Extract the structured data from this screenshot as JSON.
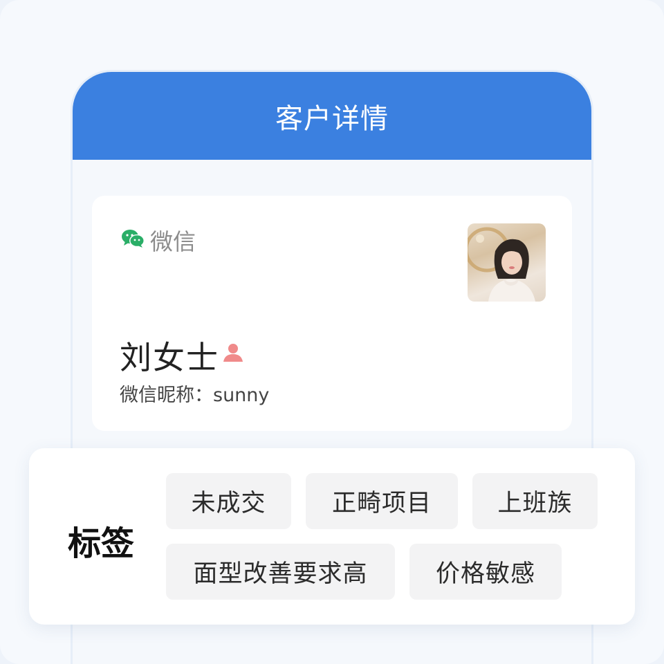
{
  "header": {
    "title": "客户详情"
  },
  "customer_card": {
    "source_icon": "wechat-icon",
    "source_label": "微信",
    "avatar": "customer-avatar-photo",
    "name": "刘女士",
    "gender_icon": "female-user-icon",
    "nickname_text": "微信昵称：sunny"
  },
  "tags": {
    "title": "标签",
    "items": [
      {
        "label": "未成交"
      },
      {
        "label": "正畸项目"
      },
      {
        "label": "上班族"
      },
      {
        "label": "面型改善要求高"
      },
      {
        "label": "价格敏感"
      }
    ]
  },
  "colors": {
    "header_blue": "#3b80e0",
    "wechat_green": "#2aae67",
    "gender_pink": "#f08a8a",
    "tag_bg": "#f3f3f4"
  }
}
